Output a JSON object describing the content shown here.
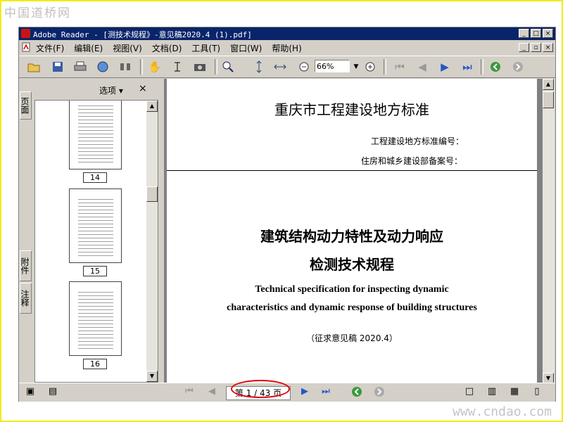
{
  "site_logo": "中国道桥网",
  "watermark": "www.cndao.com",
  "window": {
    "title": "Adobe Reader - [测技术规程》-意见稿2020.4 (1).pdf]",
    "min_glyph": "_",
    "max_glyph": "□",
    "close_glyph": "×",
    "restore_glyph": "▫"
  },
  "menus": [
    "文件(F)",
    "编辑(E)",
    "视图(V)",
    "文档(D)",
    "工具(T)",
    "窗口(W)",
    "帮助(H)"
  ],
  "toolbar": {
    "zoom_value": "66%",
    "icons": [
      "open-icon",
      "save-icon",
      "print-icon",
      "email-icon",
      "search-icon",
      "hand-tool-icon",
      "select-text-icon",
      "snapshot-icon",
      "zoom-in-tool-icon",
      "fit-page-icon",
      "fit-width-icon",
      "zoom-out-icon",
      "zoom-in-icon",
      "first-page-icon",
      "prev-page-icon",
      "next-page-icon",
      "last-page-icon",
      "go-back-icon",
      "go-forward-icon"
    ]
  },
  "sidebar": {
    "tabs": [
      "页面",
      "附件",
      "注释"
    ],
    "options_label": "选项 ▾",
    "close_label": "×",
    "thumbnails": [
      "14",
      "15",
      "16"
    ]
  },
  "document": {
    "standard_title": "重庆市工程建设地方标准",
    "standard_number_label": "工程建设地方标准编号：",
    "filing_number_label": "住房和城乡建设部备案号：",
    "title_line1": "建筑结构动力特性及动力响应",
    "title_line2": "检测技术规程",
    "english_line1": "Technical specification for inspecting dynamic",
    "english_line2": "characteristics and dynamic response of building structures",
    "draft_note": "（征求意见稿 2020.4）"
  },
  "statusbar": {
    "page_indicator": "第 1 / 43 页"
  },
  "colors": {
    "titlebar": "#0a246a",
    "chrome": "#d4d0c8",
    "highlight_ring": "#e2000a",
    "frame_border": "#f2ea1c"
  }
}
